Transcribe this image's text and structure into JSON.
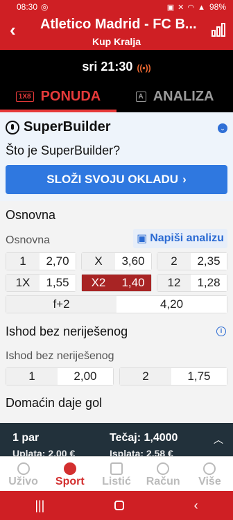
{
  "status": {
    "time": "08:30",
    "battery": "98%"
  },
  "header": {
    "title": "Atletico Madrid - FC B...",
    "subtitle": "Kup Kralja"
  },
  "match_time": "sri 21:30",
  "tabs": [
    {
      "label": "PONUDA",
      "icon": "1X8"
    },
    {
      "label": "ANALIZA",
      "icon": "A"
    }
  ],
  "superbuilder": {
    "title": "SuperBuilder",
    "question": "Što je SuperBuilder?",
    "button": "SLOŽI SVOJU OKLADU",
    "chevron": "›"
  },
  "osnovna": {
    "section": "Osnovna",
    "sub": "Osnovna",
    "analiza_btn": "Napiši analizu",
    "odds": [
      {
        "label": "1",
        "value": "2,70"
      },
      {
        "label": "X",
        "value": "3,60"
      },
      {
        "label": "2",
        "value": "2,35"
      },
      {
        "label": "1X",
        "value": "1,55"
      },
      {
        "label": "X2",
        "value": "1,40"
      },
      {
        "label": "12",
        "value": "1,28"
      },
      {
        "label": "f+2",
        "value": "4,20"
      }
    ]
  },
  "ishod": {
    "section": "Ishod bez neriješenog",
    "sub": "Ishod bez neriješenog",
    "odds": [
      {
        "label": "1",
        "value": "2,00"
      },
      {
        "label": "2",
        "value": "1,75"
      }
    ]
  },
  "domacin": {
    "section": "Domaćin daje gol"
  },
  "betbar": {
    "par": "1 par",
    "tecaj": "Tečaj: 1,4000",
    "isplata1": "Uplata: 2,00 €",
    "isplata2": "Isplata: 2,58 €"
  },
  "nav": [
    "Uživo",
    "Sport",
    "Listić",
    "Račun",
    "Više"
  ],
  "colors": {
    "brand_red": "#cf1f24",
    "selected": "#a82424",
    "accent_blue": "#2f78e0"
  }
}
